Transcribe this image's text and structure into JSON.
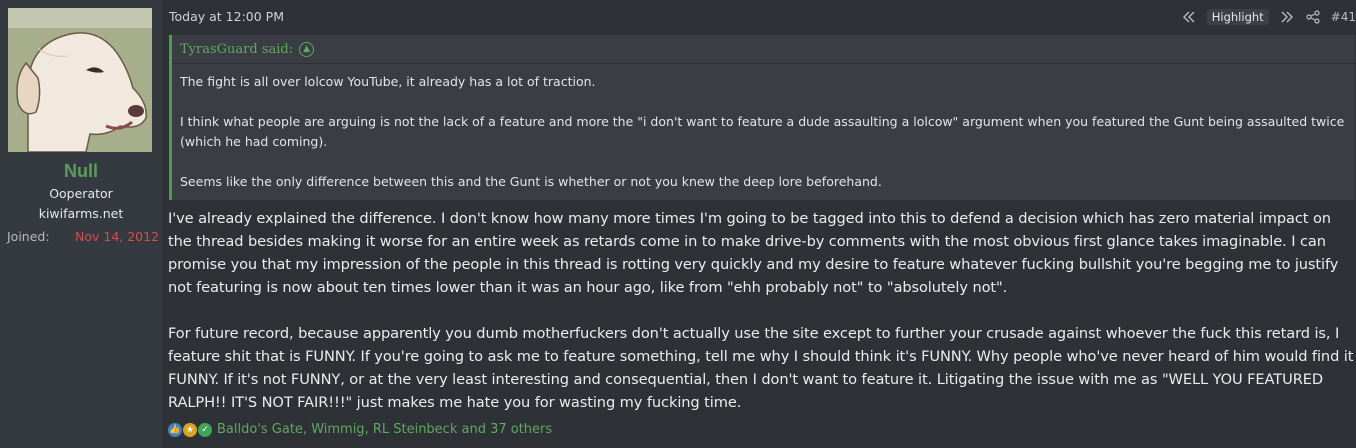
{
  "user": {
    "name": "Null",
    "title1": "Ooperator",
    "title2": "kiwifarms.net",
    "joined_label": "Joined:",
    "joined_date": "Nov 14, 2012"
  },
  "post": {
    "date": "Today at 12:00 PM",
    "highlight_label": "Highlight",
    "number": "#41"
  },
  "quote": {
    "author": "TyrasGuard said:",
    "paragraphs": [
      "The fight is all over lolcow YouTube, it already has a lot of traction.",
      "I think what people are arguing is not the lack of a feature and more the \"i don't want to feature a dude assaulting a lolcow\" argument when you featured the Gunt being assaulted twice (which he had coming).",
      "Seems like the only difference between this and the Gunt is whether or not you knew the deep lore beforehand."
    ]
  },
  "message": {
    "paragraphs": [
      "I've already explained the difference. I don't know how many more times I'm going to be tagged into this to defend a decision which has zero material impact on the thread besides making it worse for an entire week as retards come in to make drive-by comments with the most obvious first glance takes imaginable. I can promise you that my impression of the people in this thread is rotting very quickly and my desire to feature whatever fucking bullshit you're begging me to justify not featuring is now about ten times lower than it was an hour ago, like from \"ehh probably not\" to \"absolutely not\".",
      "For future record, because apparently you dumb motherfuckers don't actually use the site except to further your crusade against whoever the fuck this retard is, I feature shit that is FUNNY. If you're going to ask me to feature something, tell me why I should think it's FUNNY. Why people who've never heard of him would find it FUNNY. If it's not FUNNY, or at the very least interesting and consequential, then I don't want to feature it. Litigating the issue with me as \"WELL YOU FEATURED RALPH!! IT'S NOT FAIR!!!\" just makes me hate you for wasting my fucking time."
    ]
  },
  "reactions": {
    "icons": [
      "like-icon",
      "winner-icon",
      "check-icon"
    ],
    "list": "Balldo's Gate, Wimmig, RL Steinbeck and 37 others"
  },
  "colors": {
    "accent_green": "#5c9e5c",
    "joined_date_red": "#d64e4e",
    "background": "#2c2f34"
  }
}
